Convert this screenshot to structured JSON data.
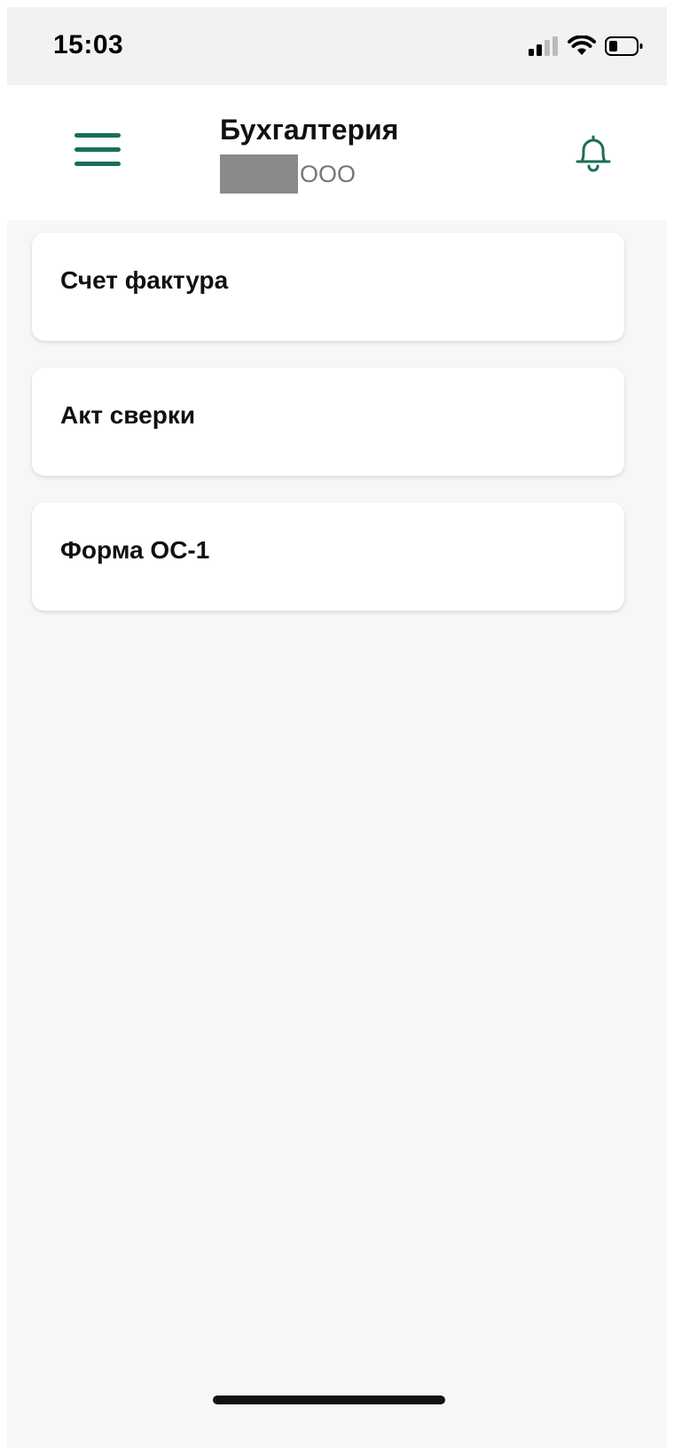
{
  "status_bar": {
    "time": "15:03"
  },
  "header": {
    "title": "Бухгалтерия",
    "subtitle_visible": "ООО",
    "accent_color": "#1a6e5a",
    "menu_icon": "hamburger-menu-icon",
    "notification_icon": "bell-icon"
  },
  "menu_items": [
    {
      "label": "Счет фактура"
    },
    {
      "label": "Акт сверки"
    },
    {
      "label": "Форма ОС-1"
    }
  ]
}
